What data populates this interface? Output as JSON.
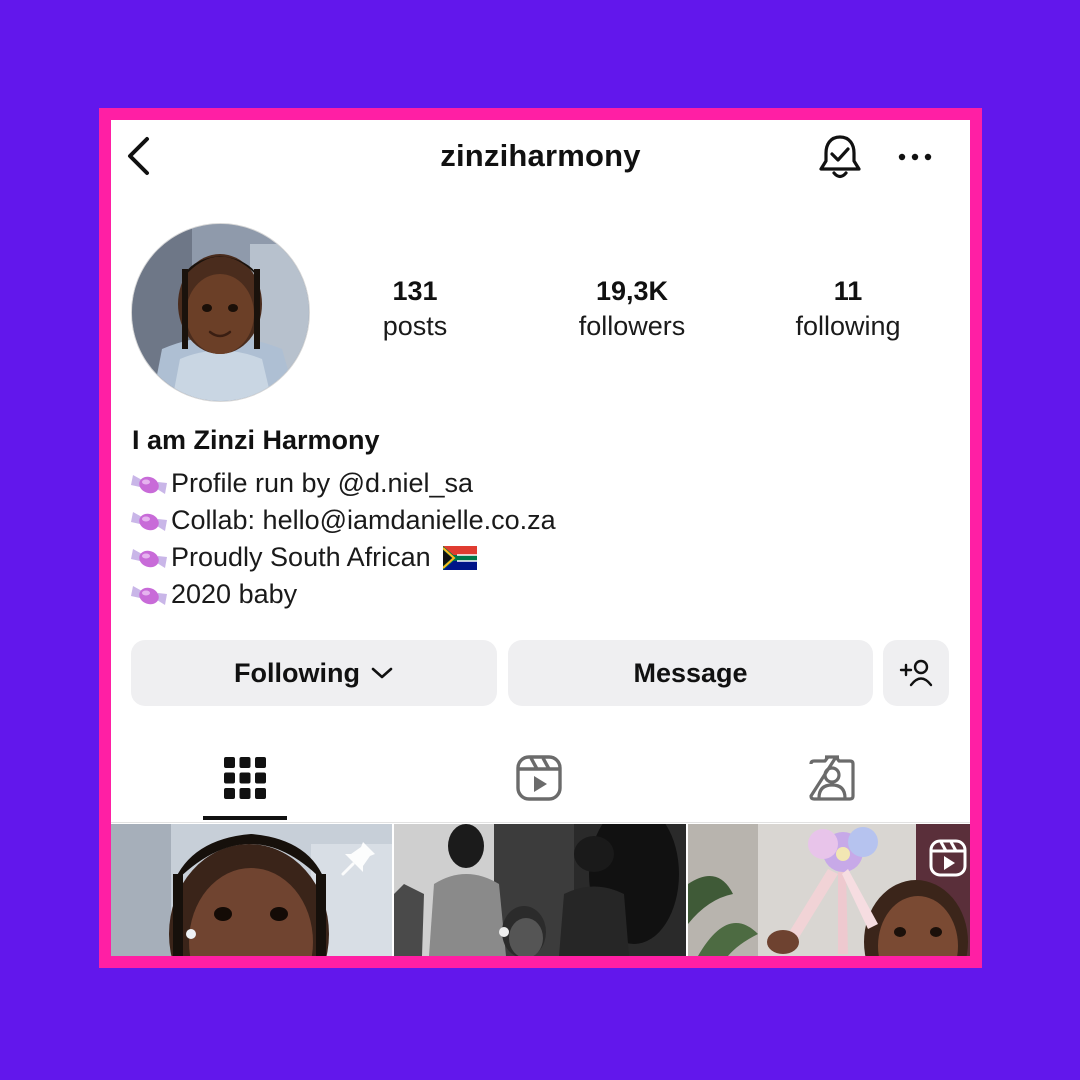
{
  "header": {
    "username": "zinziharmony",
    "back_icon": "chevron-left-icon",
    "notification_icon": "bell-check-icon",
    "more_icon": "more-horizontal-icon"
  },
  "stats": {
    "posts": {
      "value": "131",
      "label": "posts"
    },
    "followers": {
      "value": "19,3K",
      "label": "followers"
    },
    "following": {
      "value": "11",
      "label": "following"
    }
  },
  "bio": {
    "name": "I am Zinzi Harmony",
    "bullet_icon": "candy-icon",
    "lines": [
      "Profile run by @d.niel_sa",
      "Collab: hello@iamdanielle.co.za",
      "Proudly South African",
      "2020 baby"
    ],
    "flag_icon": "south-africa-flag-icon"
  },
  "actions": {
    "following_label": "Following",
    "message_label": "Message",
    "add_user_icon": "add-person-icon"
  },
  "tabs": [
    {
      "icon": "grid-icon",
      "selected": true
    },
    {
      "icon": "reels-icon",
      "selected": false
    },
    {
      "icon": "tagged-icon",
      "selected": false
    }
  ],
  "posts": [
    {
      "badge": "pin-icon"
    },
    {
      "badge": ""
    },
    {
      "badge": "reel-icon"
    }
  ],
  "colors": {
    "background": "#6217ec",
    "frame": "#ff1fa4",
    "button": "#efeff1",
    "text": "#111111"
  }
}
